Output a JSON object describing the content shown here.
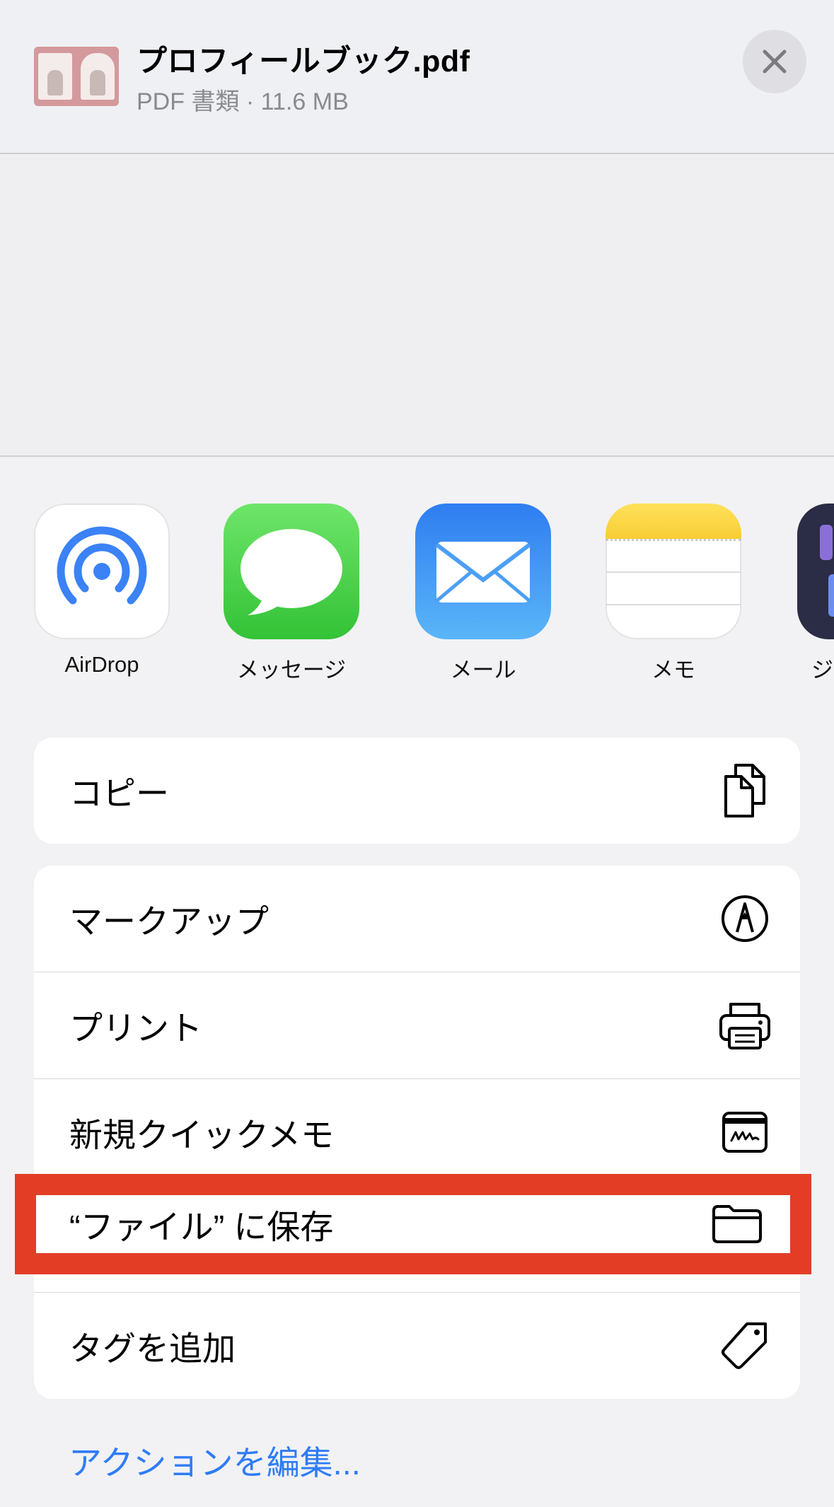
{
  "header": {
    "file_name": "プロフィールブック.pdf",
    "file_meta": "PDF 書類 · 11.6 MB"
  },
  "apps": [
    {
      "label": "AirDrop",
      "icon": "airdrop-icon"
    },
    {
      "label": "メッセージ",
      "icon": "messages-icon"
    },
    {
      "label": "メール",
      "icon": "mail-icon"
    },
    {
      "label": "メモ",
      "icon": "notes-icon"
    },
    {
      "label": "ジ",
      "icon": "app-icon"
    }
  ],
  "actions_group1": [
    {
      "label": "コピー",
      "icon": "copy-icon"
    }
  ],
  "actions_group2": [
    {
      "label": "マークアップ",
      "icon": "markup-icon"
    },
    {
      "label": "プリント",
      "icon": "printer-icon"
    },
    {
      "label": "新規クイックメモ",
      "icon": "quick-note-icon"
    },
    {
      "label": "“ファイル” に保存",
      "icon": "folder-icon"
    },
    {
      "label": "タグを追加",
      "icon": "tag-icon"
    }
  ],
  "edit_actions_label": "アクションを編集...",
  "colors": {
    "accent": "#2f7cf6",
    "highlight": "#e33d26",
    "background": "#f2f2f4"
  }
}
